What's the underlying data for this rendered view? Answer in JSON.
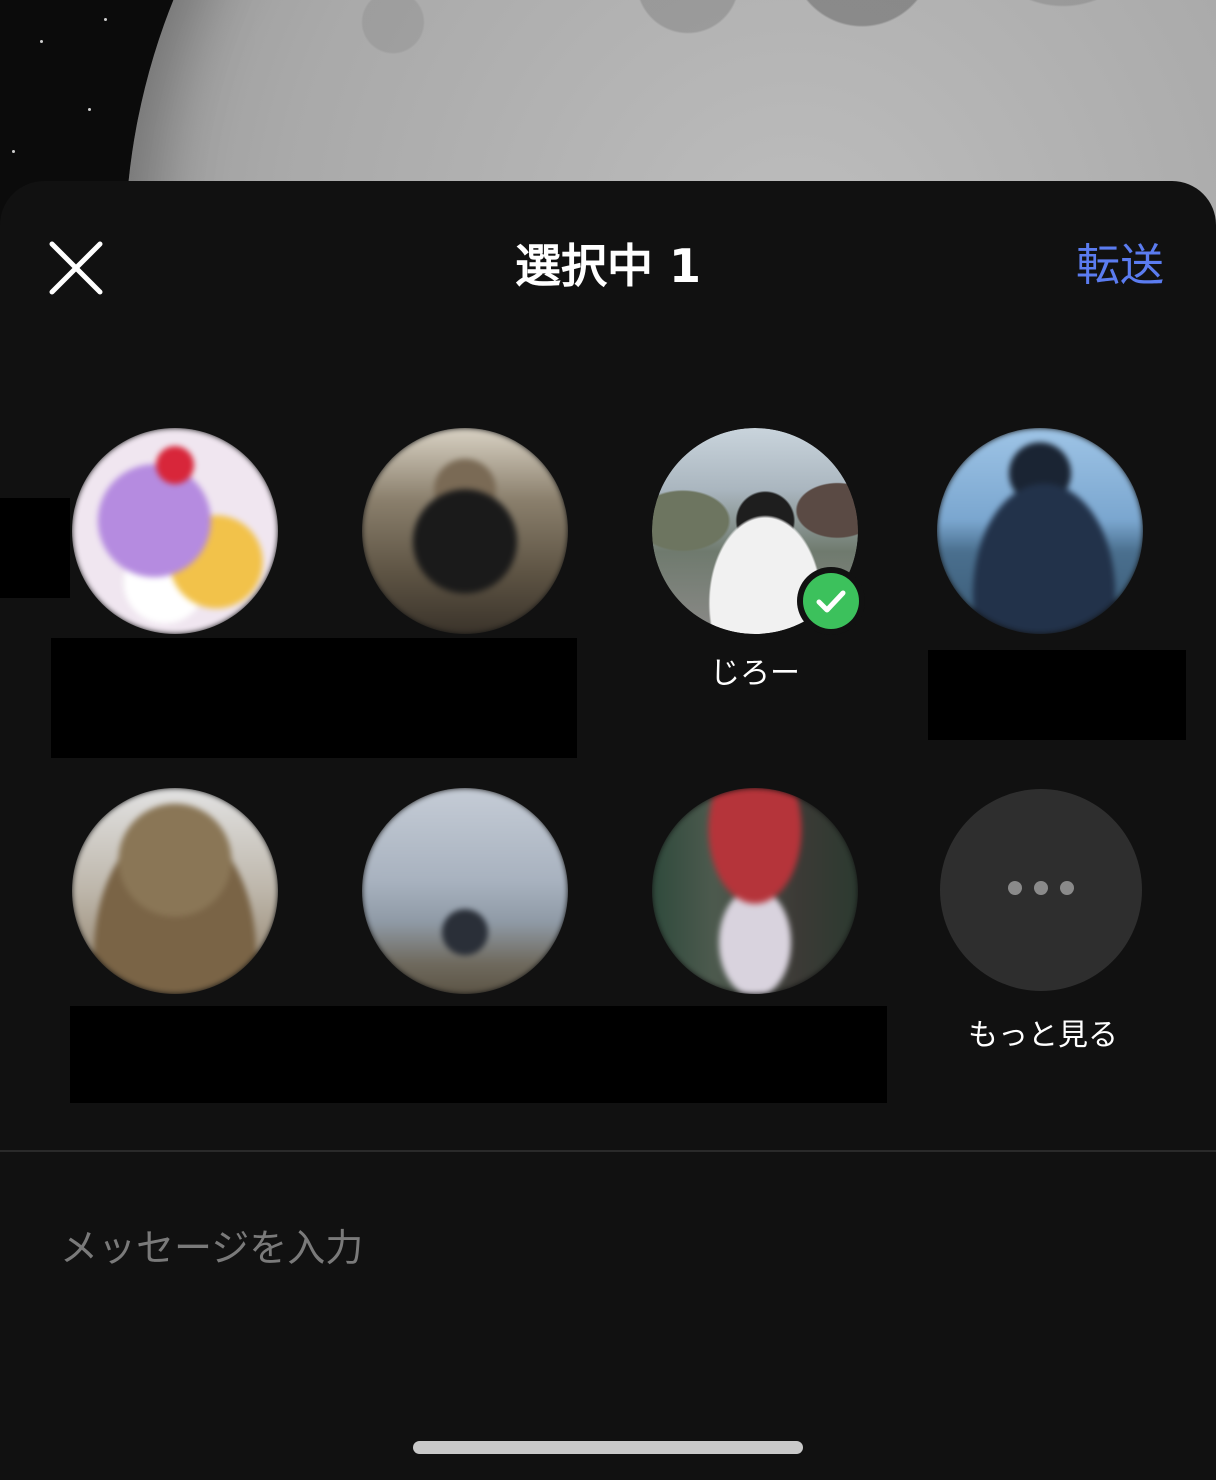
{
  "header": {
    "title": "選択中 1",
    "forward_label": "転送",
    "close_icon": "close-icon"
  },
  "contacts": [
    {
      "id": "contact-1",
      "name": "",
      "selected": false
    },
    {
      "id": "contact-2",
      "name": "",
      "selected": false
    },
    {
      "id": "contact-3",
      "name": "じろー",
      "selected": true
    },
    {
      "id": "contact-4",
      "name": "",
      "selected": false
    },
    {
      "id": "contact-5",
      "name": "",
      "selected": false
    },
    {
      "id": "contact-6",
      "name": "",
      "selected": false
    },
    {
      "id": "contact-7",
      "name": "",
      "selected": false
    }
  ],
  "more": {
    "label": "もっと見る",
    "icon": "more-dots-icon"
  },
  "message": {
    "placeholder": "メッセージを入力",
    "value": ""
  },
  "colors": {
    "sheet_background": "#111111",
    "accent": "#5b7cf0",
    "check": "#3cc15c"
  }
}
